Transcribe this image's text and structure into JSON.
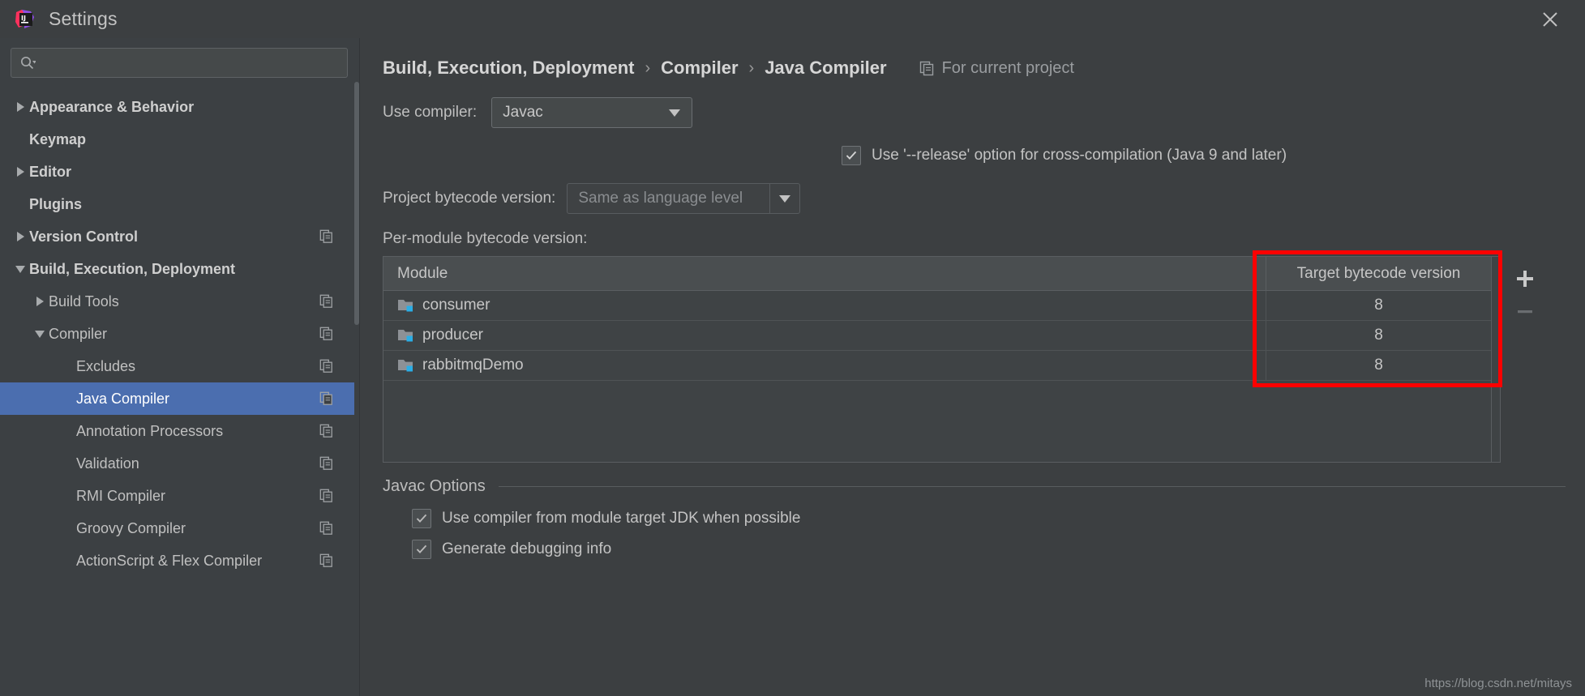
{
  "window": {
    "title": "Settings",
    "logo_icon": "intellij-idea-logo",
    "close_icon": "close-icon"
  },
  "search": {
    "placeholder": "",
    "value": "",
    "icon": "search-icon"
  },
  "sidebar": {
    "items": [
      {
        "label": "Appearance & Behavior",
        "level": 0,
        "twisty": "right",
        "selected": false,
        "copy_icon": false
      },
      {
        "label": "Keymap",
        "level": 0,
        "twisty": "none",
        "selected": false,
        "copy_icon": false
      },
      {
        "label": "Editor",
        "level": 0,
        "twisty": "right",
        "selected": false,
        "copy_icon": false
      },
      {
        "label": "Plugins",
        "level": 0,
        "twisty": "none",
        "selected": false,
        "copy_icon": false
      },
      {
        "label": "Version Control",
        "level": 0,
        "twisty": "right",
        "selected": false,
        "copy_icon": true
      },
      {
        "label": "Build, Execution, Deployment",
        "level": 0,
        "twisty": "down",
        "selected": false,
        "copy_icon": false
      },
      {
        "label": "Build Tools",
        "level": 1,
        "twisty": "right",
        "selected": false,
        "copy_icon": true
      },
      {
        "label": "Compiler",
        "level": 1,
        "twisty": "down",
        "selected": false,
        "copy_icon": true
      },
      {
        "label": "Excludes",
        "level": 2,
        "twisty": "none",
        "selected": false,
        "copy_icon": true
      },
      {
        "label": "Java Compiler",
        "level": 2,
        "twisty": "none",
        "selected": true,
        "copy_icon": true
      },
      {
        "label": "Annotation Processors",
        "level": 2,
        "twisty": "none",
        "selected": false,
        "copy_icon": true
      },
      {
        "label": "Validation",
        "level": 2,
        "twisty": "none",
        "selected": false,
        "copy_icon": true
      },
      {
        "label": "RMI Compiler",
        "level": 2,
        "twisty": "none",
        "selected": false,
        "copy_icon": true
      },
      {
        "label": "Groovy Compiler",
        "level": 2,
        "twisty": "none",
        "selected": false,
        "copy_icon": true
      },
      {
        "label": "ActionScript & Flex Compiler",
        "level": 2,
        "twisty": "none",
        "selected": false,
        "copy_icon": true
      }
    ]
  },
  "breadcrumb": {
    "parts": [
      "Build, Execution, Deployment",
      "Compiler",
      "Java Compiler"
    ],
    "separator": "›",
    "scope_label": "For current project",
    "scope_icon": "copy-scope-icon"
  },
  "compiler": {
    "use_compiler_label": "Use compiler:",
    "use_compiler_value": "Javac",
    "release_option": {
      "label": "Use '--release' option for cross-compilation (Java 9 and later)",
      "checked": true
    },
    "project_bytecode_label": "Project bytecode version:",
    "project_bytecode_value": "Same as language level",
    "project_bytecode_disabled": true,
    "per_module_label": "Per-module bytecode version:"
  },
  "table": {
    "columns": [
      "Module",
      "Target bytecode version"
    ],
    "rows": [
      {
        "module": "consumer",
        "target": "8",
        "icon": "module-folder-icon"
      },
      {
        "module": "producer",
        "target": "8",
        "icon": "module-folder-icon"
      },
      {
        "module": "rabbitmqDemo",
        "target": "8",
        "icon": "module-folder-icon"
      }
    ],
    "add_button": "+",
    "remove_button": "−"
  },
  "javac_options": {
    "title": "Javac Options",
    "options": [
      {
        "label": "Use compiler from module target JDK when possible",
        "checked": true
      },
      {
        "label": "Generate debugging info",
        "checked": true
      }
    ]
  },
  "annotation": {
    "highlight_color": "#fe0000"
  },
  "watermark": "https://blog.csdn.net/mitays"
}
